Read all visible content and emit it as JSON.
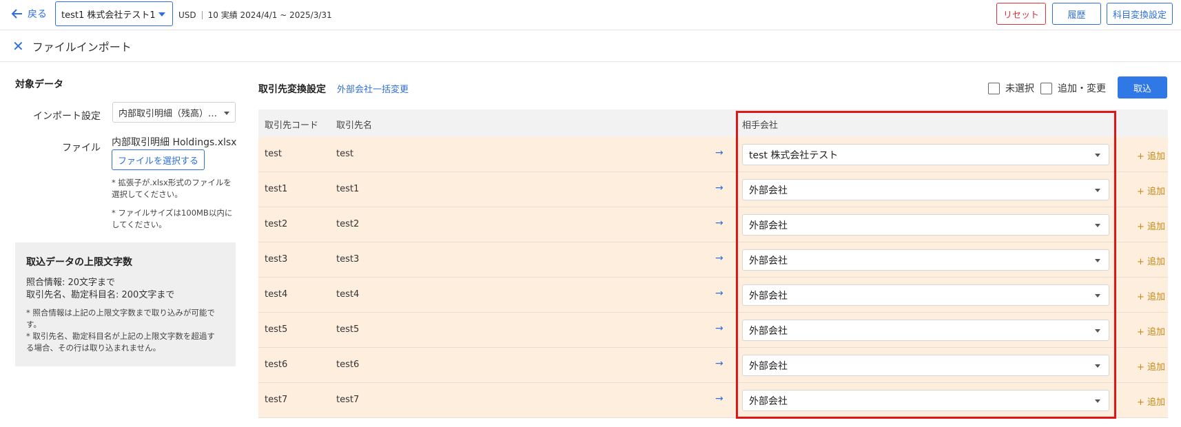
{
  "header": {
    "back_label": "戻る",
    "company": "test1 株式会社テスト1",
    "currency": "USD",
    "period": "10 実績 2024/4/1 ~ 2025/3/31",
    "reset_label": "リセット",
    "history_label": "履歴",
    "mapping_label": "科目変換設定"
  },
  "subheader": {
    "title": "ファイルインポート"
  },
  "left": {
    "title": "対象データ",
    "import_label": "インポート設定",
    "import_value": "内部取引明細（残高）…",
    "file_label": "ファイル",
    "file_name": "内部取引明細 Holdings.xlsx",
    "file_button": "ファイルを選択する",
    "note1_line1": "* 拡張子が.xlsx形式のファイルを",
    "note1_line2": "選択してください。",
    "note2_line1": "* ファイルサイズは100MB以内に",
    "note2_line2": "してください。",
    "info": {
      "title": "取込データの上限文字数",
      "line1": "照合情報: 20文字まで",
      "line2": "取引先名、勘定科目名: 200文字まで",
      "note1_line1": "* 照合情報は上記の上限文字数まで取り込みが可能で",
      "note1_line2": "す。",
      "note2_line1": "* 取引先名、勘定科目名が上記の上限文字数を超過す",
      "note2_line2": "る場合、その行は取り込まれません。"
    }
  },
  "main": {
    "section_title": "取引先変換設定",
    "bulk_link": "外部会社一括変更",
    "unselected_label": "未選択",
    "add_change_label": "追加・変更",
    "import_button": "取込",
    "columns": {
      "code": "取引先コード",
      "name": "取引先名",
      "partner": "相手会社"
    },
    "add_label": "+ 追加",
    "arrow": "→",
    "rows": [
      {
        "code": "test",
        "name": "test",
        "partner": "test 株式会社テスト"
      },
      {
        "code": "test1",
        "name": "test1",
        "partner": "外部会社"
      },
      {
        "code": "test2",
        "name": "test2",
        "partner": "外部会社"
      },
      {
        "code": "test3",
        "name": "test3",
        "partner": "外部会社"
      },
      {
        "code": "test4",
        "name": "test4",
        "partner": "外部会社"
      },
      {
        "code": "test5",
        "name": "test5",
        "partner": "外部会社"
      },
      {
        "code": "test6",
        "name": "test6",
        "partner": "外部会社"
      },
      {
        "code": "test7",
        "name": "test7",
        "partner": "外部会社"
      }
    ]
  },
  "colors": {
    "accent": "#2f6fdd",
    "danger": "#e0303a",
    "row_bg": "#fdeedd",
    "highlight": "#e01515"
  }
}
